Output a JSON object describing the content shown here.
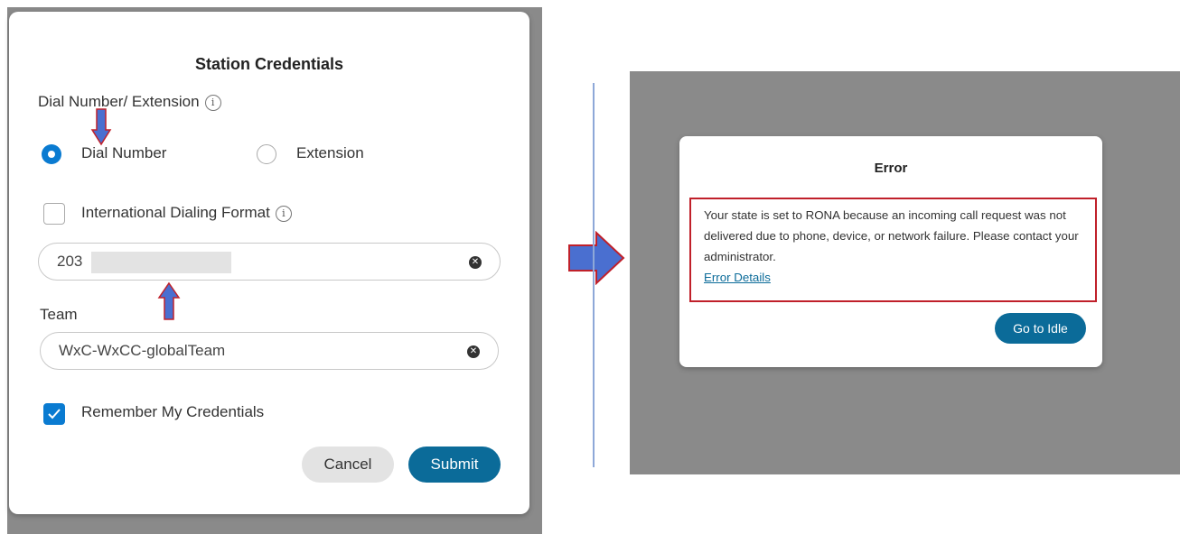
{
  "station_dialog": {
    "title": "Station Credentials",
    "dial_section_label": "Dial Number/ Extension",
    "options": [
      {
        "label": "Dial Number",
        "selected": true
      },
      {
        "label": "Extension",
        "selected": false
      }
    ],
    "international_label": "International Dialing Format",
    "international_checked": false,
    "dial_number_value": "203",
    "team_label": "Team",
    "team_value": "WxC-WxCC-globalTeam",
    "remember_label": "Remember My Credentials",
    "remember_checked": true,
    "cancel_label": "Cancel",
    "submit_label": "Submit"
  },
  "error_dialog": {
    "title": "Error",
    "message": "Your state is set to RONA because an incoming call request was not delivered due to phone, device, or network failure. Please contact your administrator.",
    "link_label": "Error Details",
    "button_label": "Go to Idle"
  },
  "icons": [
    "info-icon",
    "clear-icon",
    "checkmark-icon",
    "arrow-down-icon",
    "arrow-up-icon",
    "arrow-right-icon"
  ],
  "colors": {
    "accent": "#0a7bd1",
    "primary_button": "#0b6b99",
    "highlight_border": "#c0202a",
    "annotation_arrow": "#4a6fd0"
  }
}
